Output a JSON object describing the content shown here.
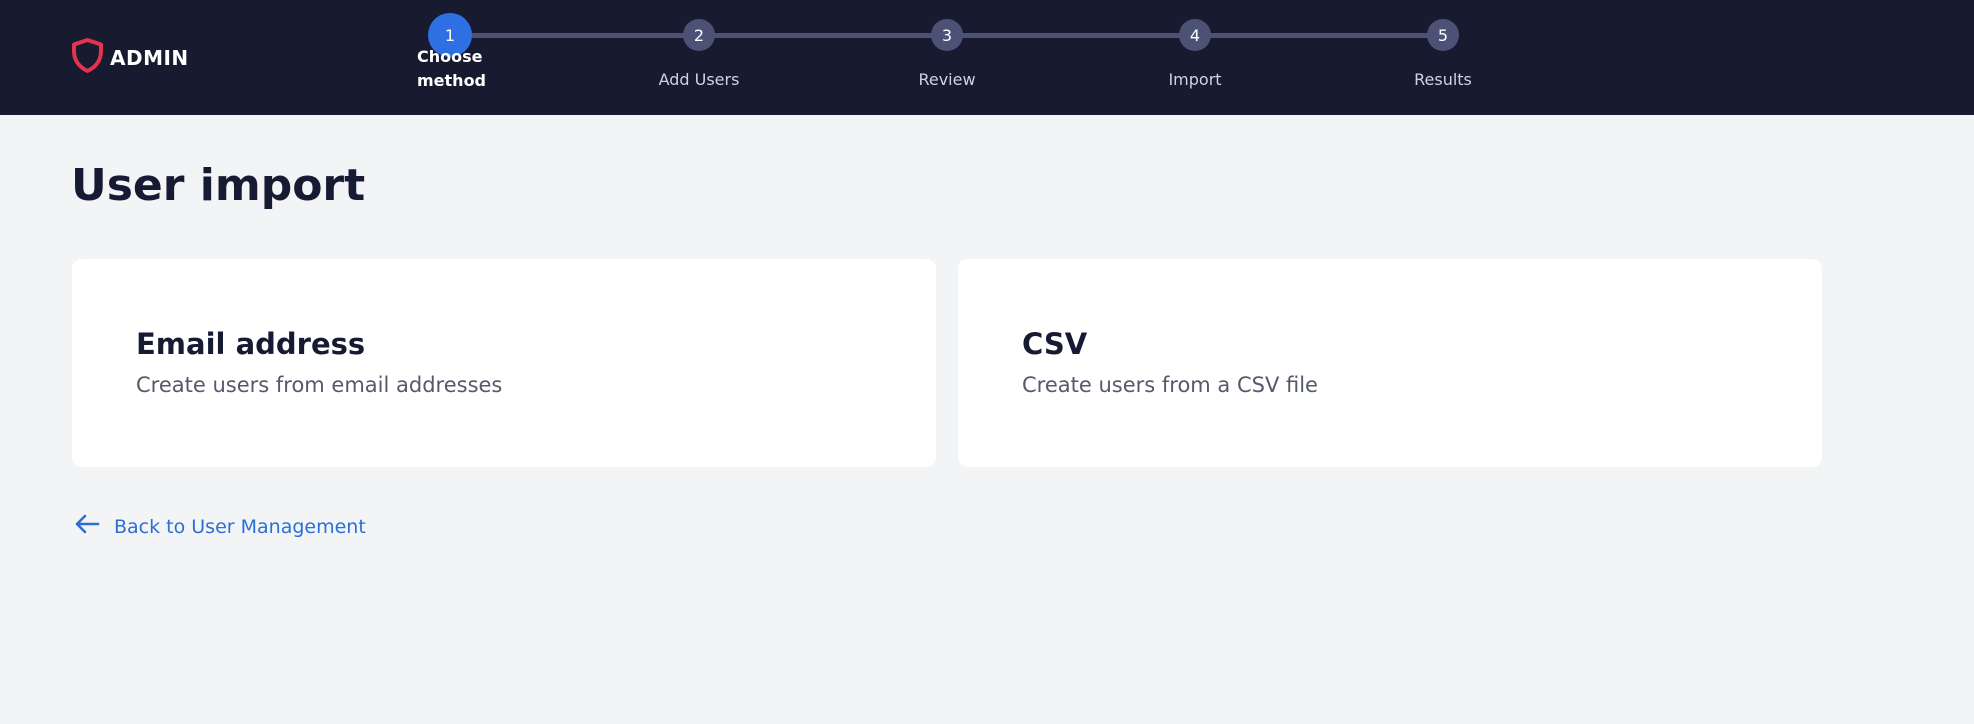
{
  "header": {
    "logo_text": "ADMIN",
    "logo_color": "#e2344e",
    "background": "#181a2f"
  },
  "stepper": {
    "active_index": 0,
    "steps": [
      {
        "number": "1",
        "label": "Choose method"
      },
      {
        "number": "2",
        "label": "Add Users"
      },
      {
        "number": "3",
        "label": "Review"
      },
      {
        "number": "4",
        "label": "Import"
      },
      {
        "number": "5",
        "label": "Results"
      }
    ],
    "colors": {
      "active": "#2f6fe4",
      "inactive": "#4b5276"
    }
  },
  "main": {
    "title": "User import",
    "options": [
      {
        "title": "Email address",
        "description": "Create users from email addresses"
      },
      {
        "title": "CSV",
        "description": "Create users from a CSV file"
      }
    ],
    "back_link": "Back to User Management",
    "link_color": "#2b6fd6"
  }
}
